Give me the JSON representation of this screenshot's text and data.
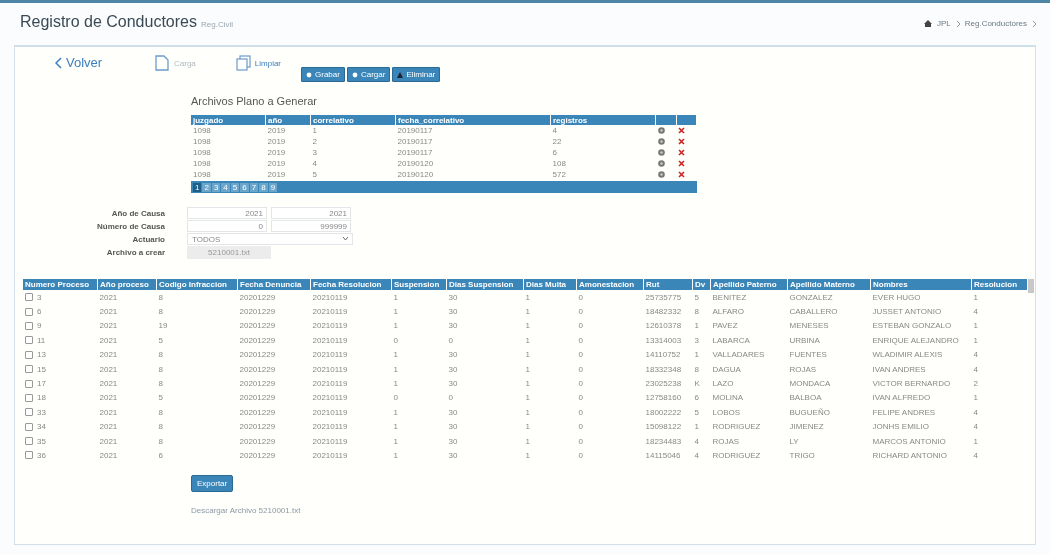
{
  "header": {
    "title": "Registro de Conductores",
    "subtitle": "Reg.Civil",
    "breadcrumb": [
      "JPL",
      "Reg.Conductores"
    ]
  },
  "toolbar": {
    "back": "Volver",
    "actions": [
      {
        "kind": "file",
        "label": "Carga",
        "disabled": true
      },
      {
        "kind": "copy",
        "label": "Limpiar",
        "disabled": false
      }
    ],
    "buttons": [
      {
        "kind": "save",
        "label": "Grabar"
      },
      {
        "kind": "load",
        "label": "Cargar"
      },
      {
        "kind": "delete",
        "label": "Eliminar"
      }
    ]
  },
  "files": {
    "title": "Archivos Plano a Generar",
    "columns": [
      "juzgado",
      "año",
      "correlativo",
      "fecha_correlativo",
      "registros"
    ],
    "rows": [
      [
        "1098",
        "2019",
        "1",
        "20190117",
        "4"
      ],
      [
        "1098",
        "2019",
        "2",
        "20190117",
        "22"
      ],
      [
        "1098",
        "2019",
        "3",
        "20190117",
        "6"
      ],
      [
        "1098",
        "2019",
        "4",
        "20190120",
        "108"
      ],
      [
        "1098",
        "2019",
        "5",
        "20190120",
        "572"
      ]
    ],
    "pages": [
      {
        "label": "1",
        "selected": true
      },
      {
        "label": "2",
        "selected": false
      },
      {
        "label": "3",
        "selected": false
      },
      {
        "label": "4",
        "selected": false
      },
      {
        "label": "5",
        "selected": false
      },
      {
        "label": "6",
        "selected": false
      },
      {
        "label": "7",
        "selected": false
      },
      {
        "label": "8",
        "selected": false
      },
      {
        "label": "9",
        "selected": false
      }
    ]
  },
  "form": {
    "fields": [
      {
        "kind": "range",
        "label": "Año de Causa",
        "from": "2021",
        "to": "2021"
      },
      {
        "kind": "range",
        "label": "Número de Causa",
        "from": "0",
        "to": "999999"
      },
      {
        "kind": "select",
        "label": "Actuario",
        "value": "TODOS"
      },
      {
        "kind": "readonly",
        "label": "Archivo a crear",
        "value": "5210001.txt"
      }
    ]
  },
  "grid": {
    "columns": [
      "Numero Proceso",
      "Año proceso",
      "Codigo Infraccion",
      "Fecha Denuncia",
      "Fecha Resolucion",
      "Suspension",
      "Dias Suspension",
      "Dias Multa",
      "Amonestacion",
      "Rut",
      "Dv",
      "Apellido Paterno",
      "Apellido Materno",
      "Nombres",
      "Resolucion"
    ],
    "rows": [
      {
        "checked": false,
        "cells": [
          "3",
          "2021",
          "8",
          "20201229",
          "20210119",
          "1",
          "30",
          "1",
          "0",
          "25735775",
          "5",
          "BENITEZ",
          "GONZALEZ",
          "EVER HUGO",
          "1"
        ]
      },
      {
        "checked": false,
        "cells": [
          "6",
          "2021",
          "8",
          "20201229",
          "20210119",
          "1",
          "30",
          "1",
          "0",
          "18482332",
          "8",
          "ALFARO",
          "CABALLERO",
          "JUSSET ANTONIO",
          "4"
        ]
      },
      {
        "checked": false,
        "cells": [
          "9",
          "2021",
          "19",
          "20201229",
          "20210119",
          "1",
          "30",
          "1",
          "0",
          "12610378",
          "1",
          "PAVEZ",
          "MENESES",
          "ESTEBAN GONZALO",
          "1"
        ]
      },
      {
        "checked": false,
        "cells": [
          "11",
          "2021",
          "5",
          "20201229",
          "20210119",
          "0",
          "0",
          "1",
          "0",
          "13314003",
          "3",
          "LABARCA",
          "URBINA",
          "ENRIQUE ALEJANDRO",
          "1"
        ]
      },
      {
        "checked": false,
        "cells": [
          "13",
          "2021",
          "8",
          "20201229",
          "20210119",
          "1",
          "30",
          "1",
          "0",
          "14110752",
          "1",
          "VALLADARES",
          "FUENTES",
          "WLADIMIR ALEXIS",
          "4"
        ]
      },
      {
        "checked": false,
        "cells": [
          "15",
          "2021",
          "8",
          "20201229",
          "20210119",
          "1",
          "30",
          "1",
          "0",
          "18332348",
          "8",
          "DAGUA",
          "ROJAS",
          "IVAN ANDRES",
          "4"
        ]
      },
      {
        "checked": false,
        "cells": [
          "17",
          "2021",
          "8",
          "20201229",
          "20210119",
          "1",
          "30",
          "1",
          "0",
          "23025238",
          "K",
          "LAZO",
          "MONDACA",
          "VICTOR BERNARDO",
          "2"
        ]
      },
      {
        "checked": false,
        "cells": [
          "18",
          "2021",
          "5",
          "20201229",
          "20210119",
          "0",
          "0",
          "1",
          "0",
          "12758160",
          "6",
          "MOLINA",
          "BALBOA",
          "IVAN ALFREDO",
          "1"
        ]
      },
      {
        "checked": false,
        "cells": [
          "33",
          "2021",
          "8",
          "20201229",
          "20210119",
          "1",
          "30",
          "1",
          "0",
          "18002222",
          "5",
          "LOBOS",
          "BUGUEÑO",
          "FELIPE ANDRES",
          "4"
        ]
      },
      {
        "checked": false,
        "cells": [
          "34",
          "2021",
          "8",
          "20201229",
          "20210119",
          "1",
          "30",
          "1",
          "0",
          "15098122",
          "1",
          "RODRIGUEZ",
          "JIMENEZ",
          "JONHS EMILIO",
          "4"
        ]
      },
      {
        "checked": false,
        "cells": [
          "35",
          "2021",
          "8",
          "20201229",
          "20210119",
          "1",
          "30",
          "1",
          "0",
          "18234483",
          "4",
          "ROJAS",
          "LY",
          "MARCOS ANTONIO",
          "1"
        ]
      },
      {
        "checked": false,
        "cells": [
          "36",
          "2021",
          "6",
          "20201229",
          "20210119",
          "1",
          "30",
          "1",
          "0",
          "14115046",
          "4",
          "RODRIGUEZ",
          "TRIGO",
          "RICHARD ANTONIO",
          "4"
        ]
      }
    ]
  },
  "export": {
    "button": "Exportar",
    "link": "Descargar Archivo 5210001.txt"
  }
}
